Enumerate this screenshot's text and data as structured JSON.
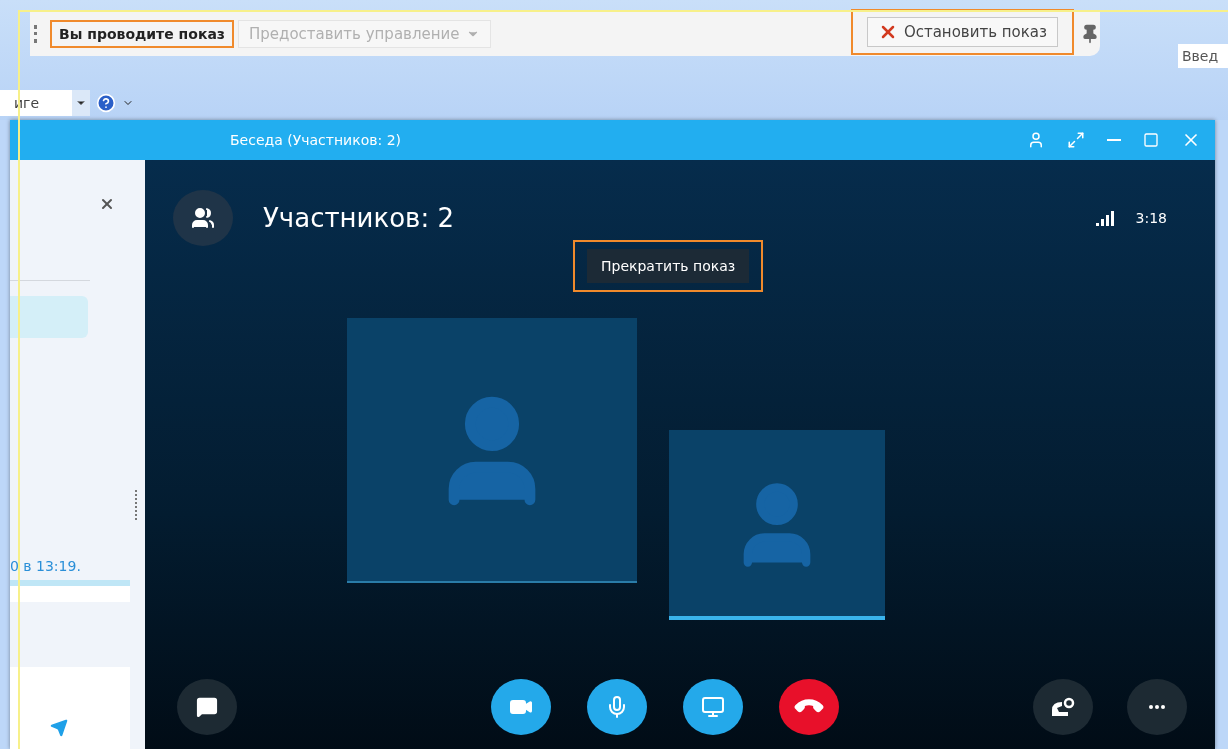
{
  "sharing_bar": {
    "status": {
      "label": "Вы проводите показ",
      "highlighted": true
    },
    "give_control": {
      "label": "Предоставить управление",
      "disabled": true
    },
    "stop_button": {
      "label": "Остановить показ",
      "highlighted": true
    }
  },
  "background_app": {
    "combo_value": "иге",
    "search_placeholder": "Введ"
  },
  "window": {
    "title": "Беседа (Участников: 2)"
  },
  "chat": {
    "timestamp": "0 в 13:19."
  },
  "call": {
    "participants_label": "Участников: 2",
    "duration": "3:18",
    "stop_share_button": {
      "label": "Прекратить показ",
      "highlighted": true
    },
    "tiles": [
      {
        "kind": "large",
        "active": false
      },
      {
        "kind": "small",
        "active": true
      }
    ],
    "controls": [
      {
        "kind": "chat"
      },
      {
        "kind": "video"
      },
      {
        "kind": "mic"
      },
      {
        "kind": "screen"
      },
      {
        "kind": "hangup"
      },
      {
        "kind": "dialpad"
      },
      {
        "kind": "more"
      }
    ]
  }
}
